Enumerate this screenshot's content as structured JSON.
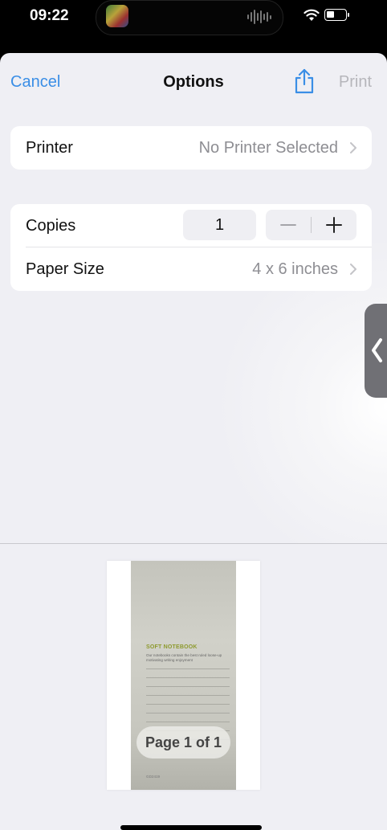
{
  "status_bar": {
    "time": "09:22"
  },
  "nav": {
    "cancel": "Cancel",
    "title": "Options",
    "print": "Print"
  },
  "printer": {
    "label": "Printer",
    "value": "No Printer Selected"
  },
  "copies": {
    "label": "Copies",
    "value": "1",
    "decrement": "−",
    "increment": "+"
  },
  "paper_size": {
    "label": "Paper Size",
    "value": "4 x 6 inches"
  },
  "preview": {
    "notebook_title": "SOFT NOTEBOOK",
    "notebook_subtitle": "Our notebooks contain the best ruled loose-up motivating writing enjoyment",
    "notebook_footer": "GD2419",
    "page_label": "Page 1 of 1"
  },
  "colors": {
    "accent": "#3a8ee6",
    "disabled": "#b6b6bb",
    "secondary_text": "#8e8e93"
  }
}
